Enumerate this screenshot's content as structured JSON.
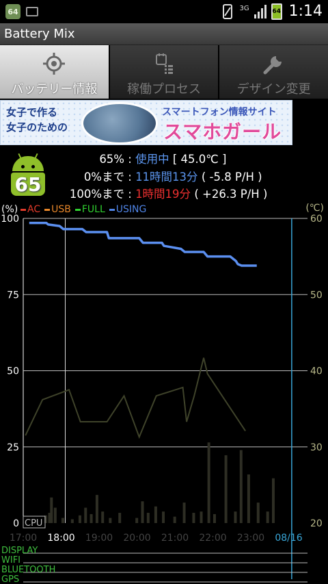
{
  "status_bar": {
    "notification_badge": "64",
    "network": "3G",
    "battery_icon_level": "64",
    "time": "1:14"
  },
  "app": {
    "title": "Battery Mix"
  },
  "tabs": [
    {
      "label": "バッテリー情報",
      "icon": "crosshair-icon",
      "active": true
    },
    {
      "label": "稼働プロセス",
      "icon": "process-list-icon",
      "active": false
    },
    {
      "label": "デザイン変更",
      "icon": "wrench-icon",
      "active": false
    }
  ],
  "banner": {
    "left_line1": "女子で作る",
    "left_line2": "女子のための",
    "top_text": "スマートフォン情報サイト",
    "logo": "スマホガール"
  },
  "battery": {
    "level": "65",
    "rows": [
      {
        "key": "65%",
        "value": "使用中",
        "extra": "[ 45.0℃ ]",
        "color": "#5b95ee"
      },
      {
        "key": "0%まで",
        "value": "11時間13分",
        "extra": "( -5.8 P/H )",
        "color": "#5b95ee"
      },
      {
        "key": "100%まで",
        "value": "1時間19分",
        "extra": "( +26.3 P/H )",
        "color": "#ee3030"
      }
    ]
  },
  "chart_data": {
    "type": "line",
    "left_unit": "(%)",
    "right_unit": "(℃)",
    "legend": [
      {
        "name": "AC",
        "color": "#e23a2a"
      },
      {
        "name": "USB",
        "color": "#e8872a"
      },
      {
        "name": "FULL",
        "color": "#30d030"
      },
      {
        "name": "USING",
        "color": "#4f84e6"
      }
    ],
    "y_left_ticks": [
      "0",
      "25",
      "50",
      "75",
      "100"
    ],
    "y_right_ticks": [
      "20",
      "30",
      "40",
      "50",
      "60"
    ],
    "x_ticks": [
      "17:00",
      "18:00",
      "19:00",
      "20:00",
      "21:00",
      "22:00",
      "23:00",
      "08/16"
    ],
    "cpu_label": "CPU",
    "series": [
      {
        "name": "USING",
        "unit": "%",
        "x": [
          0,
          0.45,
          0.5,
          0.8,
          0.9,
          1.4,
          1.5,
          2.05,
          2.1,
          2.9,
          3.0,
          3.5,
          3.55,
          4.0,
          4.1,
          4.6,
          4.7,
          5.3,
          5.45,
          5.5,
          5.6,
          6.0
        ],
        "values": [
          98.5,
          98.5,
          98,
          97.5,
          96.5,
          96.5,
          95.5,
          95.5,
          93.5,
          93.5,
          92,
          92,
          91,
          90,
          89,
          89,
          87.5,
          87.5,
          86,
          85,
          84.5,
          84.5
        ]
      },
      {
        "name": "Temperature",
        "unit": "℃",
        "x": [
          -0.3,
          0.15,
          0.85,
          1.15,
          1.85,
          2.3,
          2.7,
          3.15,
          3.85,
          3.95,
          4.15,
          4.4,
          4.5,
          5.5
        ],
        "values": [
          31.5,
          36.2,
          37.5,
          33.3,
          33.3,
          36.7,
          31.3,
          36.7,
          37.8,
          33.3,
          36.7,
          41.7,
          39.6,
          32.1
        ]
      }
    ],
    "cpu_bars": [
      {
        "x": -0.1,
        "v": 6
      },
      {
        "x": 0.0,
        "v": 8
      },
      {
        "x": 0.05,
        "v": 20
      },
      {
        "x": 0.15,
        "v": 12
      },
      {
        "x": 0.35,
        "v": 4
      },
      {
        "x": 0.6,
        "v": 3
      },
      {
        "x": 0.8,
        "v": 6
      },
      {
        "x": 0.95,
        "v": 12
      },
      {
        "x": 1.1,
        "v": 7
      },
      {
        "x": 1.25,
        "v": 22
      },
      {
        "x": 1.4,
        "v": 9
      },
      {
        "x": 1.6,
        "v": 4
      },
      {
        "x": 1.85,
        "v": 8
      },
      {
        "x": 2.3,
        "v": 4
      },
      {
        "x": 2.45,
        "v": 17
      },
      {
        "x": 2.6,
        "v": 8
      },
      {
        "x": 2.8,
        "v": 13
      },
      {
        "x": 3.0,
        "v": 9
      },
      {
        "x": 3.3,
        "v": 5
      },
      {
        "x": 3.55,
        "v": 16
      },
      {
        "x": 3.8,
        "v": 8
      },
      {
        "x": 4.0,
        "v": 9
      },
      {
        "x": 4.2,
        "v": 63
      },
      {
        "x": 4.35,
        "v": 7
      },
      {
        "x": 4.65,
        "v": 53
      },
      {
        "x": 4.9,
        "v": 9
      },
      {
        "x": 5.05,
        "v": 57
      },
      {
        "x": 5.25,
        "v": 38
      },
      {
        "x": 5.5,
        "v": 16
      },
      {
        "x": 5.75,
        "v": 9
      },
      {
        "x": 5.9,
        "v": 35
      }
    ],
    "tracks": [
      "DISPLAY",
      "WIFI",
      "BLUETOOTH",
      "GPS"
    ]
  }
}
